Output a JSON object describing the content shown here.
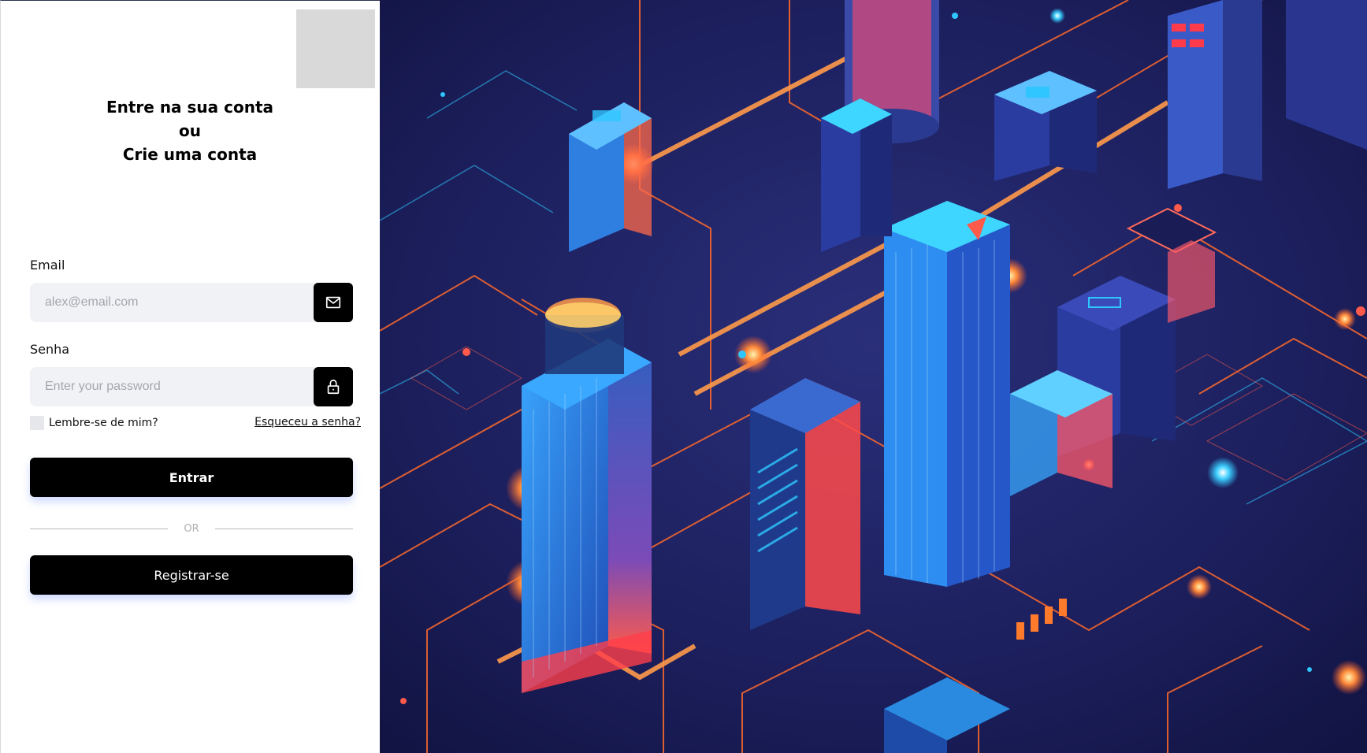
{
  "logo": {
    "alt": ""
  },
  "heading": {
    "line1": "Entre na sua conta",
    "line2": "ou",
    "line3": "Crie uma conta"
  },
  "email": {
    "label": "Email",
    "placeholder": "alex@email.com",
    "value": "",
    "icon": "mail-icon"
  },
  "password": {
    "label": "Senha",
    "placeholder": "Enter your password",
    "value": "",
    "icon": "lock-icon"
  },
  "remember": {
    "label": "Lembre-se de mim?",
    "checked": false
  },
  "forgot": {
    "label": "Esqueceu a senha?"
  },
  "login_button": {
    "label": "Entrar"
  },
  "divider": {
    "label": "OR"
  },
  "register_button": {
    "label": "Registrar-se"
  },
  "colors": {
    "button_bg": "#000000",
    "field_bg": "#f1f2f5",
    "hero_bg": "#1a1d55",
    "hero_accent_orange": "#ff6a2b",
    "hero_accent_blue": "#2fc6ff"
  }
}
